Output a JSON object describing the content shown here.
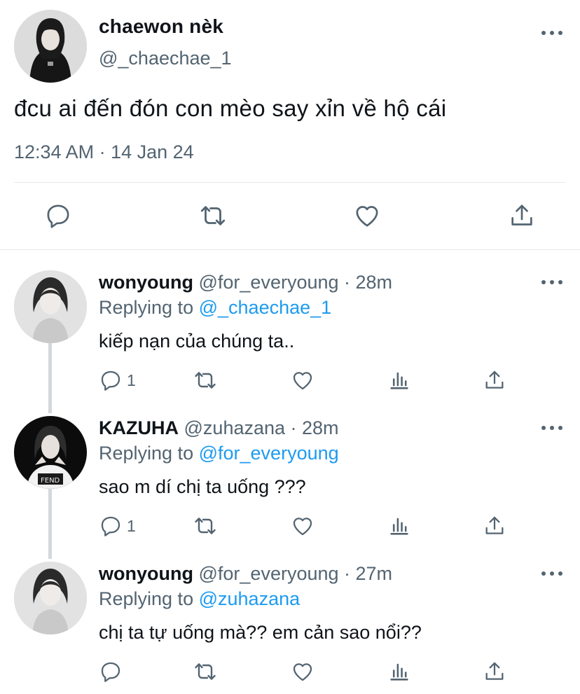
{
  "main_tweet": {
    "name": "chaewon nèk",
    "handle": "@_chaechae_1",
    "text": "đcu ai đến đón con mèo say xỉn về hộ cái",
    "timestamp": "12:34 AM · 14 Jan 24",
    "actions": [
      "reply-icon",
      "retweet-icon",
      "like-icon",
      "share-icon"
    ]
  },
  "replies": [
    {
      "name": "wonyoung",
      "meta": "@for_everyoung · 28m",
      "replying_prefix": "Replying to",
      "replying_to": "@_chaechae_1",
      "text": "kiếp nạn của chúng ta..",
      "reply_count": "1"
    },
    {
      "name": "KAZUHA",
      "meta": "@zuhazana · 28m",
      "replying_prefix": "Replying to",
      "replying_to": "@for_everyoung",
      "text": "sao m dí chị ta uống ???",
      "reply_count": "1"
    },
    {
      "name": "wonyoung",
      "meta": "@for_everyoung · 27m",
      "replying_prefix": "Replying to",
      "replying_to": "@zuhazana",
      "text": "chị ta tự uống mà?? em cản sao nổi??",
      "reply_count": ""
    }
  ],
  "colors": {
    "text": "#0f1419",
    "secondary": "#536471",
    "link": "#1d9bf0",
    "divider": "#e6e9ea",
    "thread_line": "#d4d8db"
  }
}
